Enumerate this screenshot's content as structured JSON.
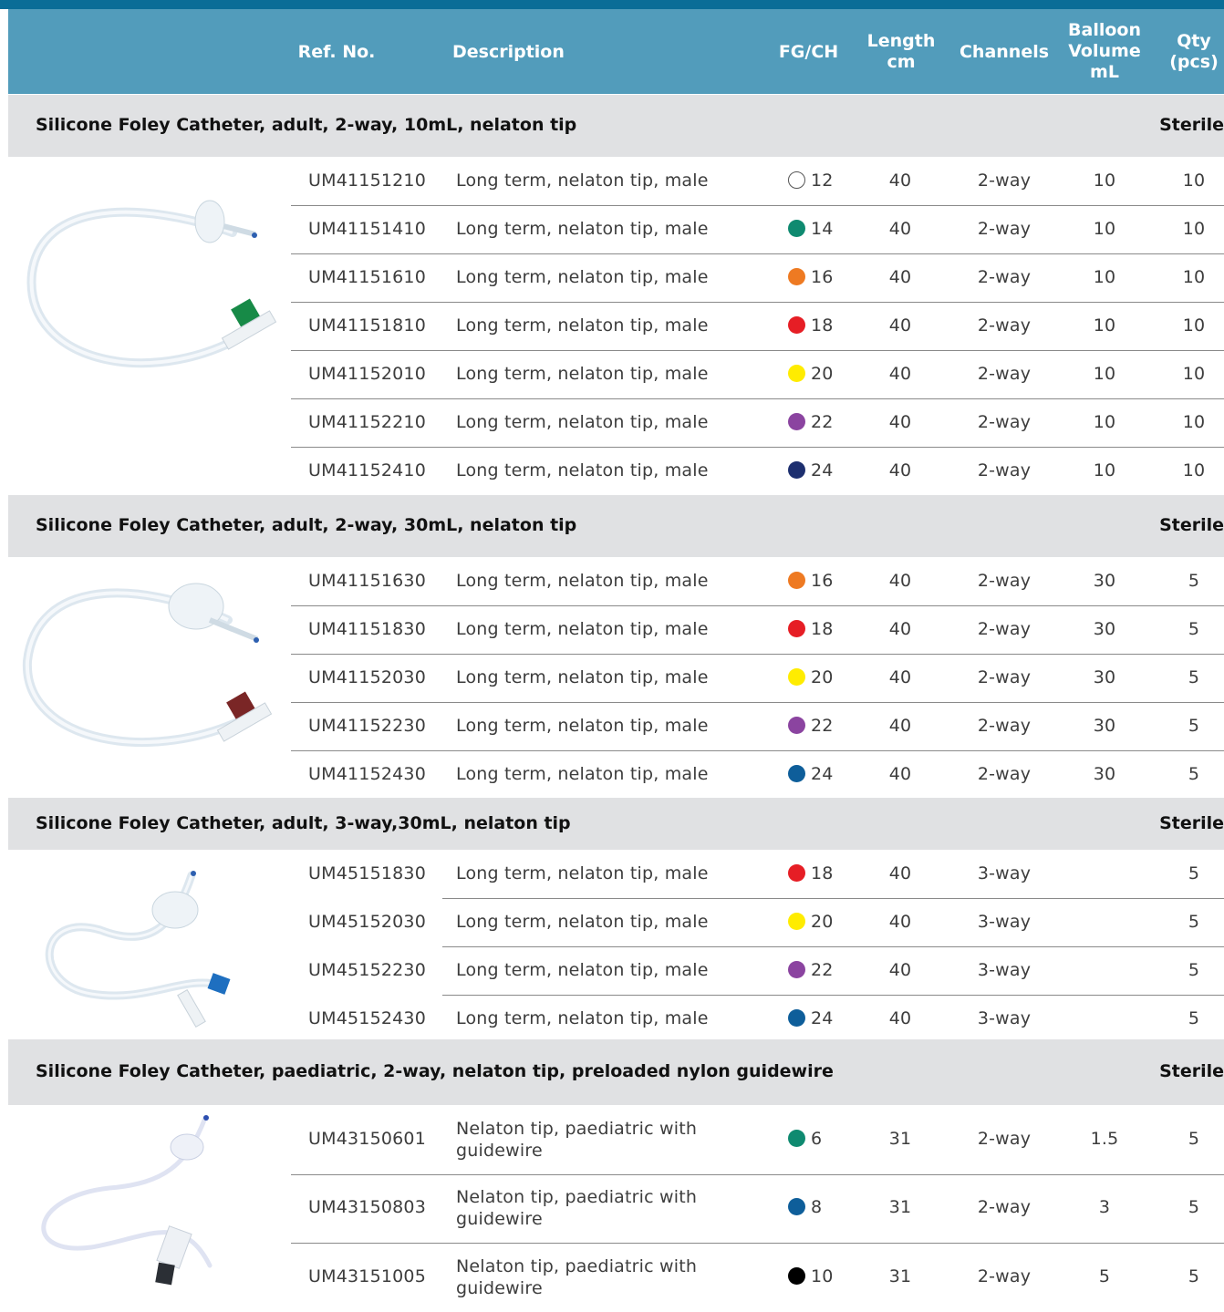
{
  "header": {
    "ref": "Ref. No.",
    "description": "Description",
    "fg": "FG/CH",
    "length": "Length\ncm",
    "channels": "Channels",
    "balloon": "Balloon\nVolume\nmL",
    "qty": "Qty\n(pcs)"
  },
  "sections": [
    {
      "title": "Silicone Foley Catheter, adult, 2-way, 10mL, nelaton tip",
      "status": "Sterile",
      "rows": [
        {
          "ref": "UM41151210",
          "desc": "Long term, nelaton tip, male",
          "color": "#ffffff",
          "fg": "12",
          "len": "40",
          "ch": "2-way",
          "vol": "10",
          "qty": "10"
        },
        {
          "ref": "UM41151410",
          "desc": "Long term, nelaton tip, male",
          "color": "#0f8a70",
          "fg": "14",
          "len": "40",
          "ch": "2-way",
          "vol": "10",
          "qty": "10"
        },
        {
          "ref": "UM41151610",
          "desc": "Long term, nelaton tip, male",
          "color": "#ee7a22",
          "fg": "16",
          "len": "40",
          "ch": "2-way",
          "vol": "10",
          "qty": "10"
        },
        {
          "ref": "UM41151810",
          "desc": "Long term, nelaton tip, male",
          "color": "#e61e25",
          "fg": "18",
          "len": "40",
          "ch": "2-way",
          "vol": "10",
          "qty": "10"
        },
        {
          "ref": "UM41152010",
          "desc": "Long term, nelaton tip, male",
          "color": "#ffec00",
          "fg": "20",
          "len": "40",
          "ch": "2-way",
          "vol": "10",
          "qty": "10"
        },
        {
          "ref": "UM41152210",
          "desc": "Long term, nelaton tip, male",
          "color": "#8b44a0",
          "fg": "22",
          "len": "40",
          "ch": "2-way",
          "vol": "10",
          "qty": "10"
        },
        {
          "ref": "UM41152410",
          "desc": "Long term, nelaton tip, male",
          "color": "#1d2f6f",
          "fg": "24",
          "len": "40",
          "ch": "2-way",
          "vol": "10",
          "qty": "10"
        }
      ]
    },
    {
      "title": "Silicone Foley Catheter, adult, 2-way, 30mL, nelaton tip",
      "status": "Sterile",
      "rows": [
        {
          "ref": "UM41151630",
          "desc": "Long term, nelaton tip, male",
          "color": "#ee7a22",
          "fg": "16",
          "len": "40",
          "ch": "2-way",
          "vol": "30",
          "qty": "5"
        },
        {
          "ref": "UM41151830",
          "desc": "Long term, nelaton tip, male",
          "color": "#e61e25",
          "fg": "18",
          "len": "40",
          "ch": "2-way",
          "vol": "30",
          "qty": "5"
        },
        {
          "ref": "UM41152030",
          "desc": "Long term, nelaton tip, male",
          "color": "#ffec00",
          "fg": "20",
          "len": "40",
          "ch": "2-way",
          "vol": "30",
          "qty": "5"
        },
        {
          "ref": "UM41152230",
          "desc": "Long term, nelaton tip, male",
          "color": "#8b44a0",
          "fg": "22",
          "len": "40",
          "ch": "2-way",
          "vol": "30",
          "qty": "5"
        },
        {
          "ref": "UM41152430",
          "desc": "Long term, nelaton tip, male",
          "color": "#0e5e9a",
          "fg": "24",
          "len": "40",
          "ch": "2-way",
          "vol": "30",
          "qty": "5"
        }
      ]
    },
    {
      "title": "Silicone Foley Catheter, adult, 3-way,30mL,  nelaton tip",
      "status": "Sterile",
      "rows": [
        {
          "ref": "UM45151830",
          "desc": "Long term, nelaton tip, male",
          "color": "#e61e25",
          "fg": "18",
          "len": "40",
          "ch": "3-way",
          "vol": "",
          "qty": "5"
        },
        {
          "ref": "UM45152030",
          "desc": "Long term, nelaton tip, male",
          "color": "#ffec00",
          "fg": "20",
          "len": "40",
          "ch": "3-way",
          "vol": "",
          "qty": "5"
        },
        {
          "ref": "UM45152230",
          "desc": "Long term, nelaton tip, male",
          "color": "#8b44a0",
          "fg": "22",
          "len": "40",
          "ch": "3-way",
          "vol": "",
          "qty": "5"
        },
        {
          "ref": "UM45152430",
          "desc": "Long term, nelaton tip, male",
          "color": "#0e5e9a",
          "fg": "24",
          "len": "40",
          "ch": "3-way",
          "vol": "",
          "qty": "5"
        }
      ]
    },
    {
      "title": "Silicone Foley Catheter, paediatric, 2-way, nelaton tip, preloaded nylon guidewire",
      "status": "Sterile",
      "rows": [
        {
          "ref": "UM43150601",
          "desc": "Nelaton tip, paediatric with guidewire",
          "color": "#0f8a70",
          "fg": "6",
          "len": "31",
          "ch": "2-way",
          "vol": "1.5",
          "qty": "5"
        },
        {
          "ref": "UM43150803",
          "desc": "Nelaton tip, paediatric with guidewire",
          "color": "#0e5e9a",
          "fg": "8",
          "len": "31",
          "ch": "2-way",
          "vol": "3",
          "qty": "5"
        },
        {
          "ref": "UM43151005",
          "desc": "Nelaton tip, paediatric with guidewire",
          "color": "#000000",
          "fg": "10",
          "len": "31",
          "ch": "2-way",
          "vol": "5",
          "qty": "5"
        }
      ]
    }
  ]
}
